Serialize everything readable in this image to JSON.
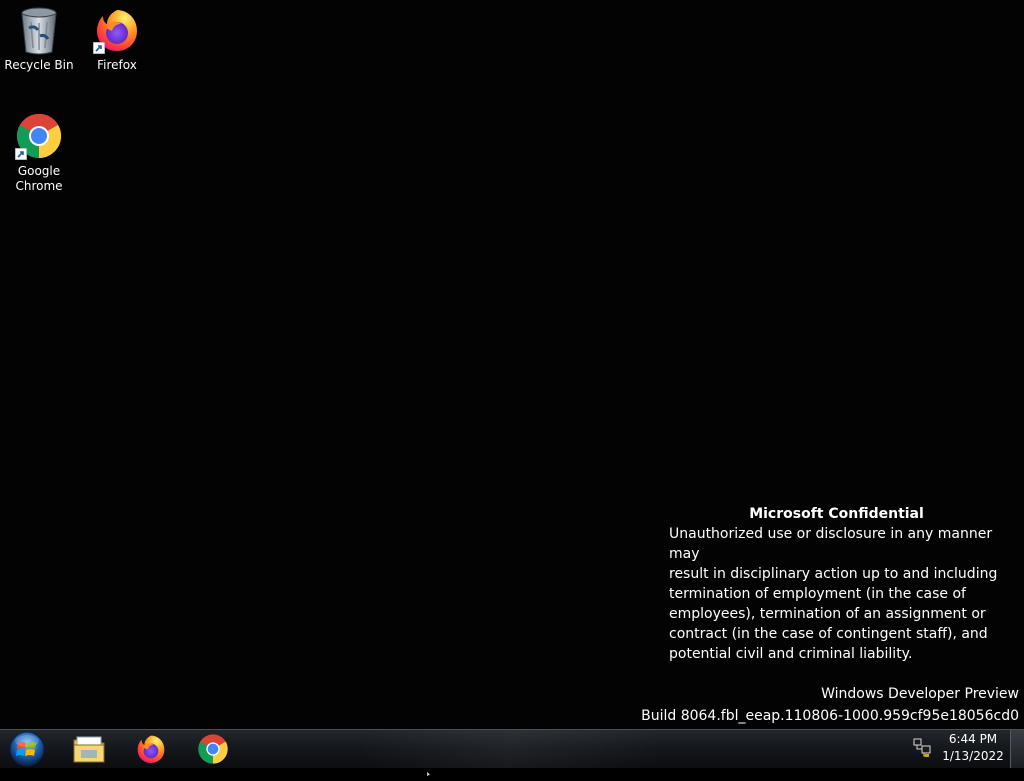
{
  "desktop": {
    "icons": [
      {
        "label": "Recycle Bin",
        "icon": "recycle-bin-icon"
      },
      {
        "label": "Firefox",
        "icon": "firefox-icon"
      },
      {
        "label": "Google Chrome",
        "icon": "chrome-icon"
      }
    ]
  },
  "confidential": {
    "title": "Microsoft Confidential",
    "body": "Unauthorized use or disclosure in any manner may\nresult in disciplinary action up to and including\ntermination of employment (in the case of\nemployees), termination of an assignment or\ncontract (in the case of contingent staff), and\npotential civil and criminal liability."
  },
  "watermark": {
    "edition": "Windows Developer Preview",
    "build": "Build 8064.fbl_eeap.110806-1000.959cf95e18056cd0"
  },
  "taskbar": {
    "start_icon": "windows-start-orb-icon",
    "pinned": [
      {
        "name": "Windows Explorer",
        "icon": "file-explorer-icon"
      },
      {
        "name": "Firefox",
        "icon": "firefox-icon"
      },
      {
        "name": "Google Chrome",
        "icon": "chrome-icon"
      }
    ],
    "tray": {
      "network_icon": "network-icon",
      "time": "6:44 PM",
      "date": "1/13/2022"
    }
  },
  "colors": {
    "desktop_bg": "#030303",
    "text": "#ffffff",
    "taskbar_top": "#23272c",
    "taskbar_bottom": "#0b0d10"
  }
}
